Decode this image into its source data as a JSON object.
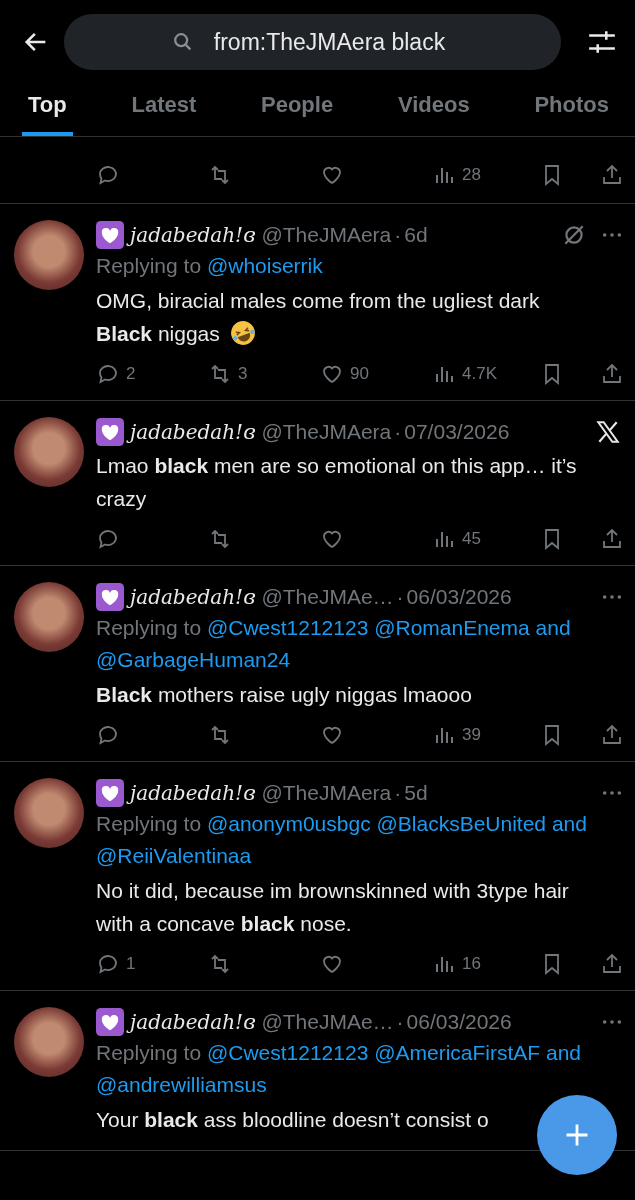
{
  "search": {
    "value": "from:TheJMAera black"
  },
  "tabs": [
    {
      "label": "Top",
      "selected": true
    },
    {
      "label": "Latest",
      "selected": false
    },
    {
      "label": "People",
      "selected": false
    },
    {
      "label": "Videos",
      "selected": false
    },
    {
      "label": "Photos",
      "selected": false
    }
  ],
  "partial_tweet": {
    "stats": {
      "views": "28"
    }
  },
  "tweets": [
    {
      "name": "jadabedah!ɞ",
      "handle": "@TheJMAera",
      "separator": "·",
      "time": "6d",
      "kind": "grok",
      "reply_prefix": "Replying to",
      "reply_to": "@whoiserrik",
      "text": "OMG, biracial males come from the ugliest dark **Black** niggas",
      "emoji": true,
      "stats": {
        "replies": "2",
        "reposts": "3",
        "likes": "90",
        "views": "4.7K"
      }
    },
    {
      "name": "jadabedah!ɞ",
      "handle": "@TheJMAera",
      "separator": "·",
      "time": "07/03/2026",
      "kind": "x",
      "text": "Lmao **black** men are so emotional on this app… it’s crazy",
      "emoji": false,
      "stats": {
        "views": "45"
      }
    },
    {
      "name": "jadabedah!ɞ",
      "handle": "@TheJMAe…",
      "separator": "·",
      "time": "06/03/2026",
      "kind": "more",
      "reply_prefix": "Replying to",
      "reply_to": "@Cwest1212123 @RomanEnema and @GarbageHuman24",
      "text": "**Black** mothers raise ugly niggas lmaooo",
      "emoji": false,
      "stats": {
        "views": "39"
      }
    },
    {
      "name": "jadabedah!ɞ",
      "handle": "@TheJMAera",
      "separator": "·",
      "time": "5d",
      "kind": "more",
      "reply_prefix": "Replying to",
      "reply_to": "@anonym0usbgc @BlacksBeUnited and @ReiiValentinaa",
      "text": "No it did, because im brownskinned with 3type hair with a concave **black** nose.",
      "emoji": false,
      "stats": {
        "replies": "1",
        "views": "16"
      }
    },
    {
      "name": "jadabedah!ɞ",
      "handle": "@TheJMAe…",
      "separator": "·",
      "time": "06/03/2026",
      "kind": "more",
      "reply_prefix": "Replying to",
      "reply_to": "@Cwest1212123 @AmericaFirstAF and @andrewilliamsus",
      "text": "Your **black** ass bloodline doesn’t consist o",
      "emoji": false
    }
  ]
}
